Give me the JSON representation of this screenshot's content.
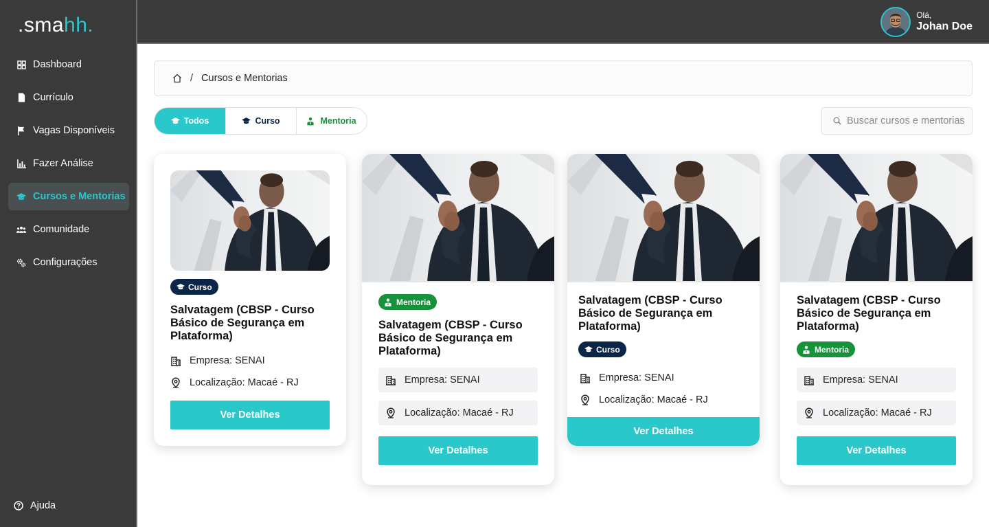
{
  "brand": {
    "logo_prefix": ".sma",
    "logo_accent": "hh.",
    "accent_color": "#2ac7cb",
    "sidebar_color": "#3a3a3a"
  },
  "sidebar": {
    "items": [
      {
        "label": "Dashboard",
        "icon": "dashboard-icon"
      },
      {
        "label": "Currículo",
        "icon": "document-icon"
      },
      {
        "label": "Vagas Disponíveis",
        "icon": "flag-icon"
      },
      {
        "label": "Fazer Análise",
        "icon": "bar-chart-icon"
      },
      {
        "label": "Cursos e Mentorias",
        "icon": "graduation-cap-icon",
        "active": true
      },
      {
        "label": "Comunidade",
        "icon": "people-icon"
      },
      {
        "label": "Configurações",
        "icon": "gears-icon"
      }
    ],
    "help_label": "Ajuda"
  },
  "header": {
    "greeting": "Olá,",
    "user_name": "Johan Doe"
  },
  "breadcrumb": {
    "current": "Cursos e Mentorias",
    "separator": "/"
  },
  "filters": {
    "todos": "Todos",
    "curso": "Curso",
    "mentoria": "Mentoria"
  },
  "search": {
    "placeholder": "Buscar cursos e mentorias"
  },
  "cards": [
    {
      "type": "Curso",
      "title": "Salvatagem (CBSP - Curso Básico de Segurança em Plataforma)",
      "company": "Empresa: SENAI",
      "location": "Localização: Macaé - RJ",
      "button": "Ver Detalhes"
    },
    {
      "type": "Mentoria",
      "title": "Salvatagem (CBSP - Curso Básico de Segurança em Plataforma)",
      "company": "Empresa: SENAI",
      "location": "Localização: Macaé - RJ",
      "button": "Ver Detalhes"
    },
    {
      "type": "Curso",
      "title": "Salvatagem (CBSP - Curso Básico de Segurança em Plataforma)",
      "company": "Empresa: SENAI",
      "location": "Localização: Macaé - RJ",
      "button": "Ver Detalhes"
    },
    {
      "type": "Mentoria",
      "title": "Salvatagem (CBSP - Curso Básico de Segurança em Plataforma)",
      "company": "Empresa: SENAI",
      "location": "Localização: Macaé - RJ",
      "button": "Ver Detalhes"
    }
  ]
}
